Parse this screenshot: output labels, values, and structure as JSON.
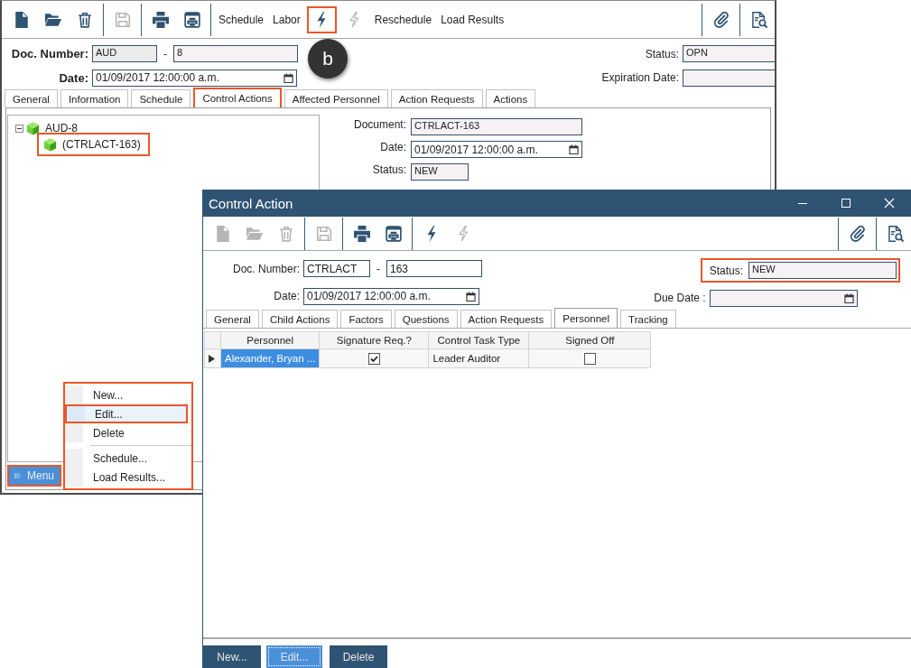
{
  "main_window": {
    "toolbar": {
      "left": [
        {
          "kind": "icon",
          "disabled": false,
          "highlighted": false
        },
        {
          "kind": "icon",
          "disabled": false,
          "highlighted": false
        },
        {
          "kind": "icon",
          "disabled": false,
          "highlighted": false
        },
        {
          "kind": "separator"
        },
        {
          "kind": "icon",
          "disabled": true,
          "highlighted": false
        },
        {
          "kind": "separator"
        },
        {
          "kind": "icon",
          "disabled": false,
          "highlighted": false
        },
        {
          "kind": "icon",
          "disabled": false,
          "highlighted": false
        },
        {
          "kind": "separator"
        },
        {
          "kind": "text",
          "label": "Schedule"
        },
        {
          "kind": "text",
          "label": "Labor"
        },
        {
          "kind": "icon",
          "disabled": false,
          "highlighted": true
        },
        {
          "kind": "icon",
          "disabled": true,
          "highlighted": false
        },
        {
          "kind": "text",
          "label": "Reschedule"
        },
        {
          "kind": "text",
          "label": "Load Results"
        }
      ],
      "right": [
        {
          "kind": "separator"
        },
        {
          "kind": "icon",
          "disabled": false,
          "highlighted": false
        },
        {
          "kind": "separator"
        },
        {
          "kind": "icon",
          "disabled": false,
          "highlighted": false
        }
      ]
    },
    "doc_number": {
      "label": "Doc. Number:",
      "prefix": "AUD",
      "dash": "-",
      "number": "8"
    },
    "date": {
      "label": "Date:",
      "value": "01/09/2017 12:00:00 a.m."
    },
    "status": {
      "label": "Status:",
      "value": "OPN"
    },
    "expiration_date": {
      "label": "Expiration Date:"
    },
    "callout": {
      "label": "b"
    },
    "tabs": [
      {
        "label": "General",
        "selected": false,
        "highlighted": false
      },
      {
        "label": "Information",
        "selected": false,
        "highlighted": false
      },
      {
        "label": "Schedule",
        "selected": false,
        "highlighted": false
      },
      {
        "label": "Control Actions",
        "selected": true,
        "highlighted": true
      },
      {
        "label": "Affected Personnel",
        "selected": false,
        "highlighted": false
      },
      {
        "label": "Action Requests",
        "selected": false,
        "highlighted": false
      },
      {
        "label": "Actions",
        "selected": false,
        "highlighted": false
      }
    ],
    "tree": [
      {
        "label": "AUD-8",
        "expanded": true,
        "highlighted": false,
        "children": [
          {
            "label": "(CTRLACT-163)",
            "highlighted": true
          }
        ]
      }
    ],
    "details": [
      {
        "kind": "text",
        "label": "Document:",
        "value": "CTRLACT-163"
      },
      {
        "kind": "date",
        "label": "Date:",
        "value": "01/09/2017 12:00:00 a.m."
      },
      {
        "kind": "short",
        "label": "Status:",
        "value": "NEW"
      }
    ],
    "menu_button": {
      "label": "Menu",
      "highlighted": true
    },
    "context_menu": {
      "highlighted": true,
      "items": [
        {
          "kind": "item",
          "label": "New...",
          "selected": false,
          "highlighted": false
        },
        {
          "kind": "item",
          "label": "Edit...",
          "selected": true,
          "highlighted": true
        },
        {
          "kind": "item",
          "label": "Delete",
          "selected": false,
          "highlighted": false
        },
        {
          "kind": "separator"
        },
        {
          "kind": "item",
          "label": "Schedule...",
          "selected": false,
          "highlighted": false
        },
        {
          "kind": "item",
          "label": "Load Results...",
          "selected": false,
          "highlighted": false
        }
      ]
    }
  },
  "dialog": {
    "title": "Control Action",
    "toolbar": {
      "left": [
        {
          "kind": "icon",
          "disabled": true
        },
        {
          "kind": "icon",
          "disabled": true
        },
        {
          "kind": "icon",
          "disabled": true
        },
        {
          "kind": "separator"
        },
        {
          "kind": "icon",
          "disabled": true
        },
        {
          "kind": "separator"
        },
        {
          "kind": "icon",
          "disabled": false
        },
        {
          "kind": "icon",
          "disabled": false
        },
        {
          "kind": "separator"
        },
        {
          "kind": "icon",
          "disabled": false
        },
        {
          "kind": "icon",
          "disabled": true
        }
      ],
      "right": [
        {
          "kind": "separator"
        },
        {
          "kind": "icon",
          "disabled": false
        },
        {
          "kind": "separator"
        },
        {
          "kind": "icon",
          "disabled": false
        }
      ]
    },
    "doc_number": {
      "label": "Doc. Number:",
      "prefix": "CTRLACT",
      "dash": "-",
      "number": "163"
    },
    "date": {
      "label": "Date:",
      "value": "01/09/2017 12:00:00 a.m."
    },
    "status": {
      "label": "Status:",
      "value": "NEW",
      "highlighted": true
    },
    "due_date": {
      "label": "Due Date :"
    },
    "tabs": [
      {
        "label": "General",
        "selected": false
      },
      {
        "label": "Child Actions",
        "selected": false
      },
      {
        "label": "Factors",
        "selected": false
      },
      {
        "label": "Questions",
        "selected": false
      },
      {
        "label": "Action Requests",
        "selected": false
      },
      {
        "label": "Personnel",
        "selected": true
      },
      {
        "label": "Tracking",
        "selected": false
      }
    ],
    "table": {
      "columns": [
        "Personnel",
        "Signature Req.?",
        "Control Task Type",
        "Signed Off"
      ],
      "rows": [
        {
          "current": true,
          "personnel": "Alexander, Bryan ...",
          "signature_required": true,
          "task_type": "Leader Auditor",
          "signed_off": false
        }
      ]
    },
    "buttons": [
      {
        "label": "New...",
        "focused": false
      },
      {
        "label": "Edit...",
        "focused": true
      },
      {
        "label": "Delete",
        "focused": false
      }
    ]
  }
}
